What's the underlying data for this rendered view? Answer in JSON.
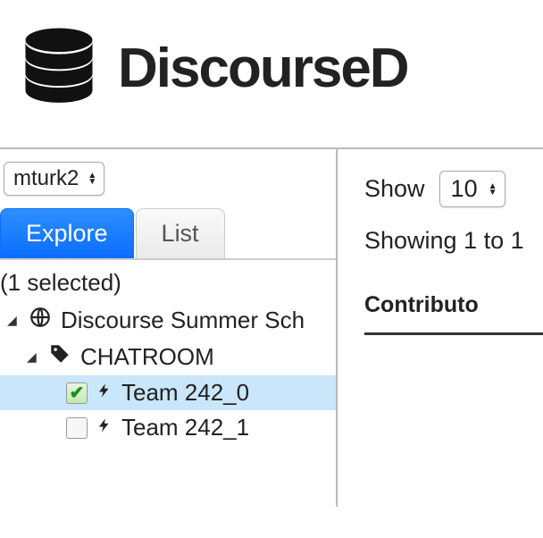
{
  "brand": "DiscourseD",
  "selector": {
    "value": "mturk2"
  },
  "tabs": {
    "explore": "Explore",
    "list": "List"
  },
  "selected_count": "(1 selected)",
  "tree": {
    "root": {
      "label": "Discourse Summer Sch"
    },
    "chatroom": {
      "label": "CHATROOM"
    },
    "team0": {
      "label": "Team 242_0"
    },
    "team1": {
      "label": "Team 242_1"
    }
  },
  "right": {
    "show_label": "Show",
    "show_value": "10",
    "showing": "Showing 1 to 1",
    "col_header": "Contributo"
  }
}
